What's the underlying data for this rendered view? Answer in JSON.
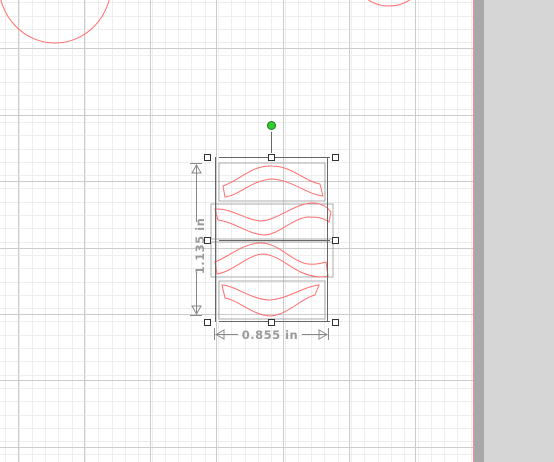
{
  "canvas": {
    "page_background": "#ffffff",
    "fine_grid_color": "#eeeeee",
    "major_grid_color": "#cccccc",
    "page_edge_color": "#ff8a8a",
    "desk_color": "#d6d6d6",
    "desk_shadow_color": "#a8a8a8"
  },
  "shapes": {
    "stroke_color": "#ff6f6f",
    "count": 4
  },
  "selection": {
    "height_label": "1.135 in",
    "width_label": "0.855 in",
    "rotate_handle_color": "#33cc33",
    "handle_color": "#ffffff",
    "guide_color": "#666666"
  }
}
